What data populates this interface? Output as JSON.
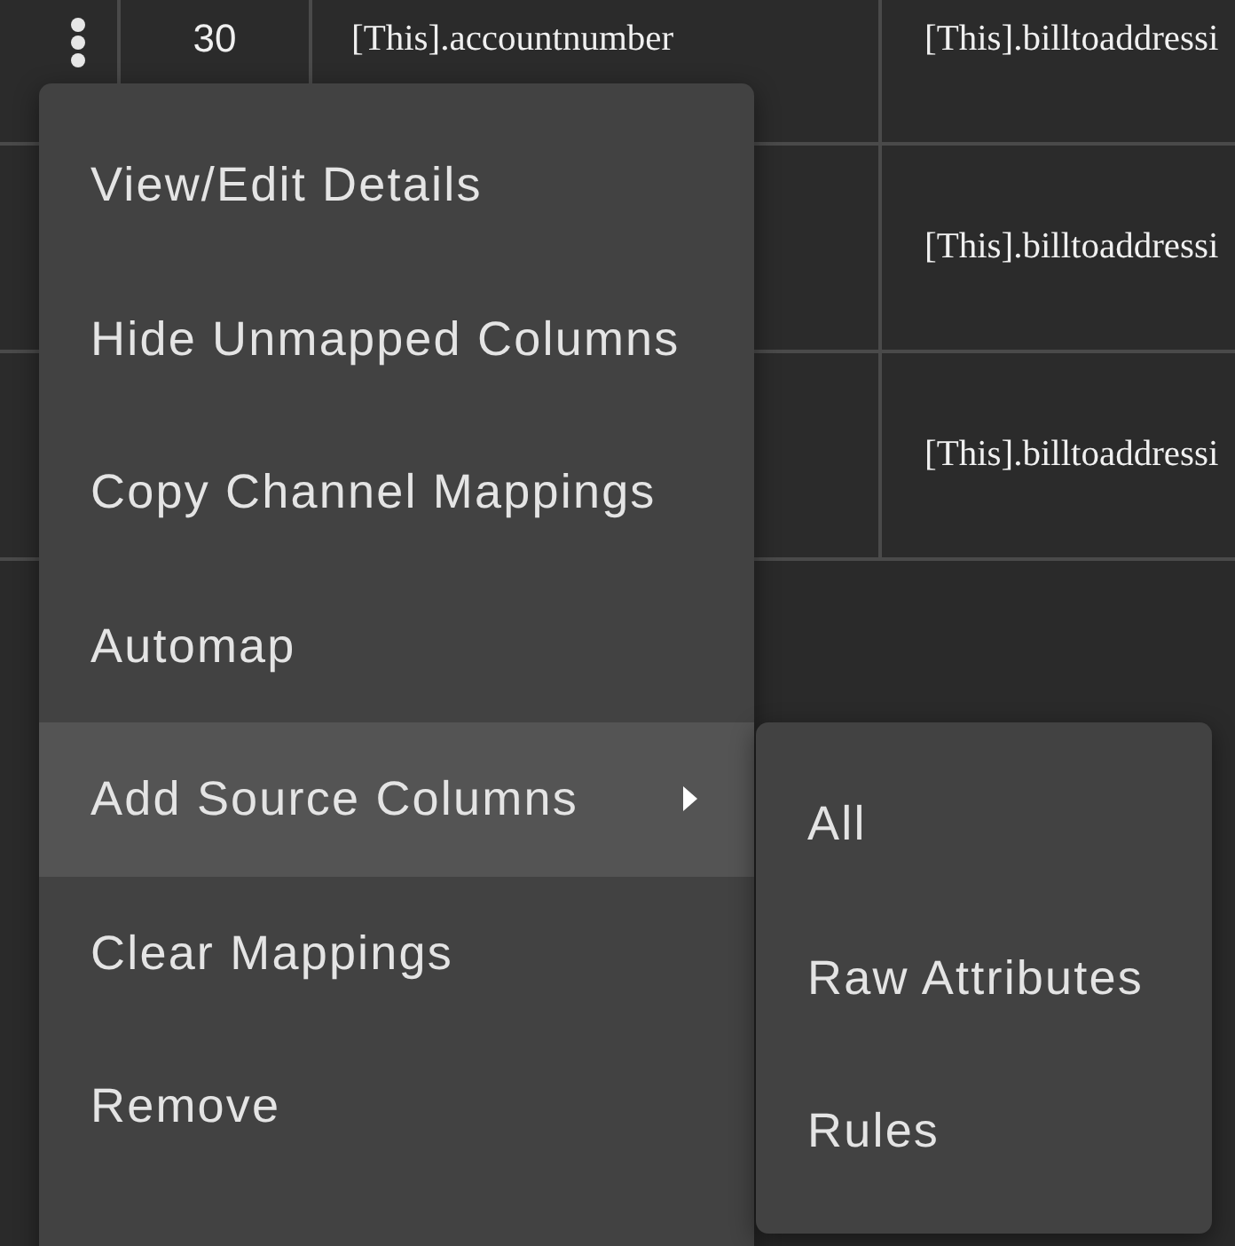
{
  "table": {
    "rows": [
      {
        "menu_button": true,
        "column_2": "30",
        "column_3": "[This].accountnumber",
        "column_4": "[This].billtoaddressi"
      },
      {
        "column_4": "[This].billtoaddressi"
      },
      {
        "column_4": "[This].billtoaddressi"
      }
    ]
  },
  "context_menu": {
    "items": [
      {
        "label": "View/Edit Details",
        "selected": false
      },
      {
        "label": "Hide Unmapped Columns",
        "selected": false
      },
      {
        "label": "Copy Channel Mappings",
        "selected": false
      },
      {
        "label": "Automap",
        "selected": false
      },
      {
        "label": "Add Source Columns",
        "selected": true,
        "has_submenu": true
      },
      {
        "label": "Clear Mappings",
        "selected": false
      },
      {
        "label": "Remove",
        "selected": false
      }
    ],
    "submenu": {
      "items": [
        {
          "label": "All",
          "selected": false
        },
        {
          "label": "Raw Attributes",
          "selected": false
        },
        {
          "label": "Rules",
          "selected": false
        }
      ]
    }
  }
}
